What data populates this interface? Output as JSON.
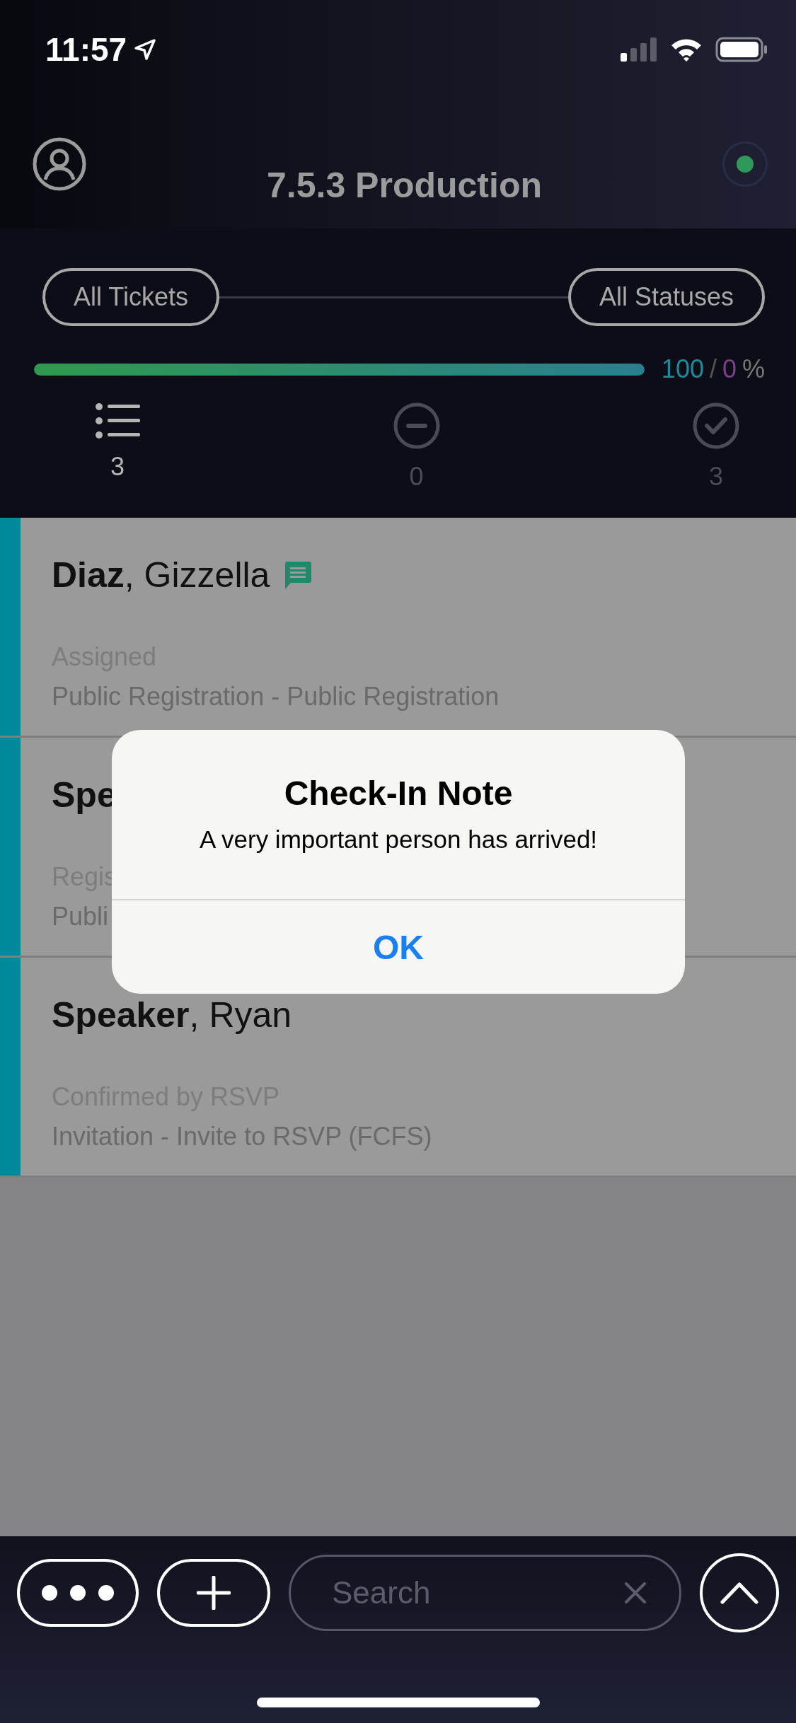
{
  "status_bar": {
    "time": "11:57"
  },
  "header": {
    "title": "7.5.3 Production",
    "connected": true
  },
  "filters": [
    {
      "label": "All Tickets"
    },
    {
      "label": "All Statuses"
    }
  ],
  "progress": {
    "level": 1.0,
    "checked_in": "100",
    "separator": "/",
    "not_checked_in": "0",
    "unit": "%"
  },
  "stats": [
    {
      "kind": "all",
      "count": "3",
      "selected": true
    },
    {
      "kind": "pending",
      "count": "0",
      "selected": false
    },
    {
      "kind": "done",
      "count": "3",
      "selected": false
    }
  ],
  "attendees": [
    {
      "name": "**Diaz**, Gizzella",
      "has_note": true,
      "status": "Assigned",
      "ticket": "Public Registration - Public Registration"
    },
    {
      "name": "**Spe**",
      "has_note": false,
      "status": "Regis",
      "ticket": "Publi"
    },
    {
      "name": "**Speaker**, Ryan",
      "has_note": false,
      "status": "Confirmed by RSVP",
      "ticket": "Invitation - Invite to RSVP (FCFS)"
    }
  ],
  "dialog": {
    "title": "Check-In Note",
    "message": "A very important person has arrived!",
    "button": "OK"
  },
  "search": {
    "placeholder": "Search"
  }
}
